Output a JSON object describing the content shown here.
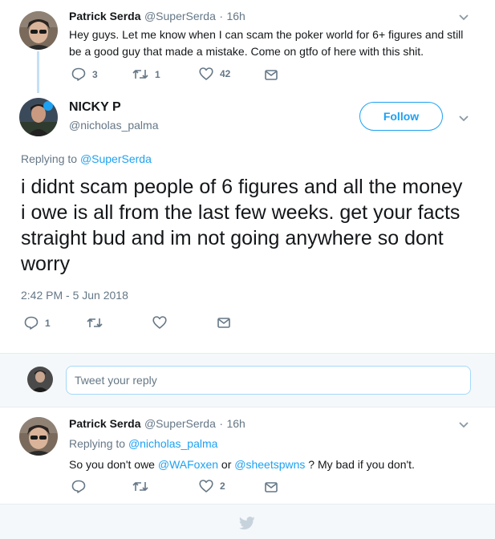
{
  "parent_tweet": {
    "display_name": "Patrick Serda",
    "handle": "@SuperSerda",
    "separator": "·",
    "time": "16h",
    "text": "Hey guys. Let me know when I can scam the poker world for 6+ figures and still be a good guy that made a mistake. Come on gtfo of here with this shit.",
    "replies": "3",
    "retweets": "1",
    "likes": "42"
  },
  "main_tweet": {
    "display_name": "NICKY P",
    "handle": "@nicholas_palma",
    "follow_label": "Follow",
    "replying_prefix": "Replying to",
    "replying_to": "@SuperSerda",
    "text": "i didnt scam people of 6 figures and all the money i owe is all from the last few weeks. get your facts straight bud and im not going anywhere so dont worry",
    "timestamp": "2:42 PM - 5 Jun 2018",
    "replies": "1"
  },
  "reply_box": {
    "placeholder": "Tweet your reply"
  },
  "reply_tweet": {
    "display_name": "Patrick Serda",
    "handle": "@SuperSerda",
    "separator": "·",
    "time": "16h",
    "replying_prefix": "Replying to",
    "replying_to": "@nicholas_palma",
    "text_1": "So you don't owe",
    "mention_1": "@WAFoxen",
    "text_2": "or",
    "mention_2": "@sheetspwns",
    "text_3": "? My bad if you don't.",
    "likes": "2"
  },
  "colors": {
    "accent": "#1da1f2",
    "muted": "#657786",
    "thread_line": "#c4e0f5",
    "divider": "#e6ecf0"
  },
  "icons": [
    "reply-icon",
    "retweet-icon",
    "like-icon",
    "dm-icon",
    "chevron-down-icon",
    "twitter-bird-icon"
  ]
}
